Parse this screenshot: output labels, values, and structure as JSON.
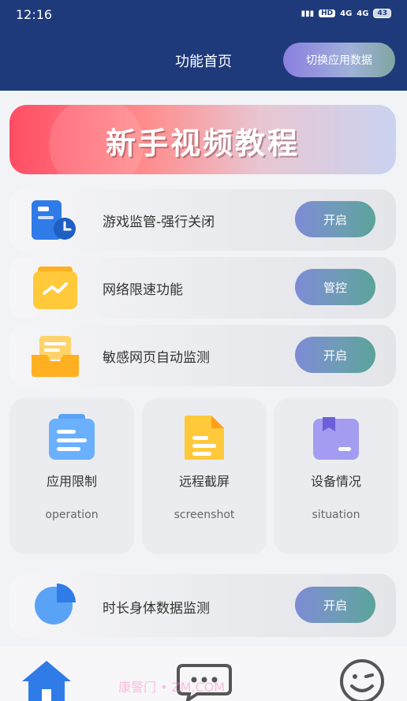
{
  "status_bar": {
    "time": "12:16",
    "network_badge": "HD",
    "signal1": "4G",
    "signal2": "4G",
    "battery": "43"
  },
  "header": {
    "title": "功能首页",
    "switch_button": "切换应用数据"
  },
  "banner": {
    "text": "新手视频教程"
  },
  "features": [
    {
      "label": "游戏监管-强行关闭",
      "button": "开启",
      "icon": "phone-clock-icon"
    },
    {
      "label": "网络限速功能",
      "button": "管控",
      "icon": "network-chart-icon"
    },
    {
      "label": "敏感网页自动监测",
      "button": "开启",
      "icon": "mail-tray-icon"
    }
  ],
  "cards": [
    {
      "title": "应用限制",
      "subtitle": "operation",
      "icon": "app-limit-icon"
    },
    {
      "title": "远程截屏",
      "subtitle": "screenshot",
      "icon": "document-icon"
    },
    {
      "title": "设备情况",
      "subtitle": "situation",
      "icon": "box-icon"
    }
  ],
  "body_monitor": {
    "label": "时长身体数据监测",
    "button": "开启",
    "icon": "pie-chart-icon"
  },
  "tabbar": {
    "home": "home-icon",
    "chat": "chat-icon",
    "me": "smile-icon"
  },
  "watermark": "康警门 • ZM.COM",
  "colors": {
    "header_bg": "#1e3a7b",
    "accent_blue": "#2f7be8",
    "accent_yellow": "#ffc93a"
  }
}
